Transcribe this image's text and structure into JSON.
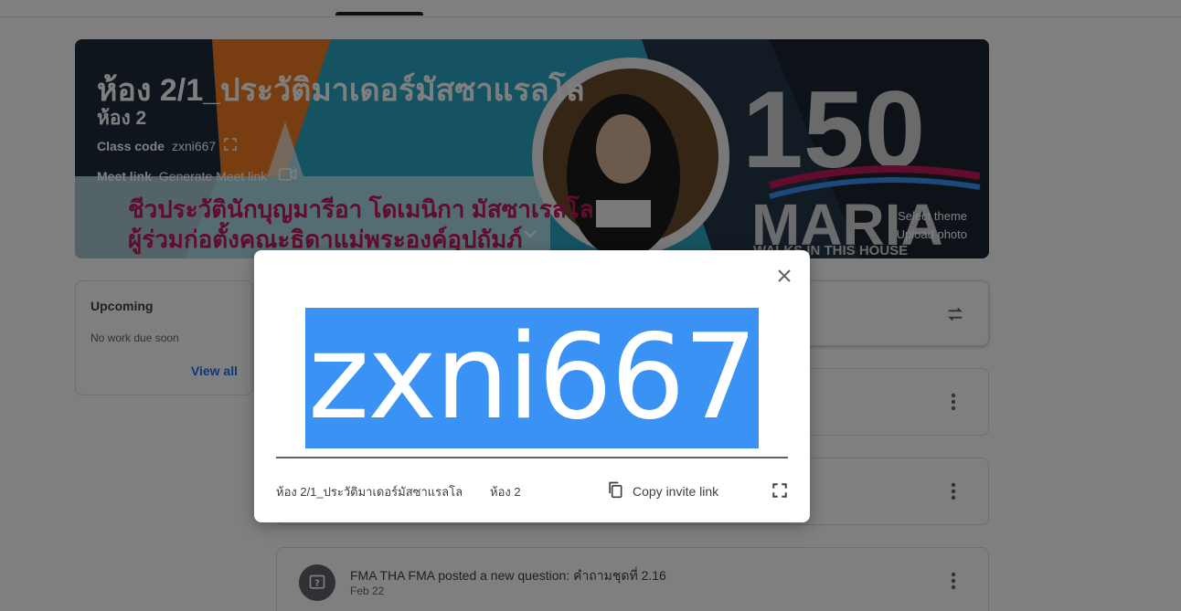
{
  "banner": {
    "title": "ห้อง 2/1_ประวัติมาเดอร์มัสซาแรลโล",
    "section": "ห้อง 2",
    "class_code_label": "Class code",
    "class_code": "zxni667",
    "meet_label": "Meet link",
    "meet_action": "Generate Meet link",
    "select_theme": "Select theme",
    "upload_photo": "Upload photo",
    "image_text_line1": "ชีวประวัตินักบุญมารีอา โดเมนิกา มัสซาเรลโล",
    "image_text_line2": "ผู้ร่วมก่อตั้งคณะธิดาแม่พระองค์อุปถัมภ์",
    "image_logo_text": "150 FMA MARIA WALKS IN THIS HOUSE"
  },
  "upcoming": {
    "title": "Upcoming",
    "empty_text": "No work due soon",
    "view_all": "View all"
  },
  "stream": {
    "post": {
      "title": "FMA THA FMA posted a new question: คำถามชุดที่ 2.16",
      "date": "Feb 22"
    }
  },
  "dialog": {
    "code": "zxni667",
    "class_name": "ห้อง 2/1_ประวัติมาเดอร์มัสซาแรลโล",
    "section": "ห้อง 2",
    "copy_invite": "Copy invite link",
    "code_highlight_color": "#3a92f5"
  },
  "icons": [
    "close-icon",
    "copy-icon",
    "fullscreen-icon",
    "video-camera-icon",
    "swap-icon",
    "more-vert-icon",
    "question-icon",
    "chevron-down-icon"
  ]
}
